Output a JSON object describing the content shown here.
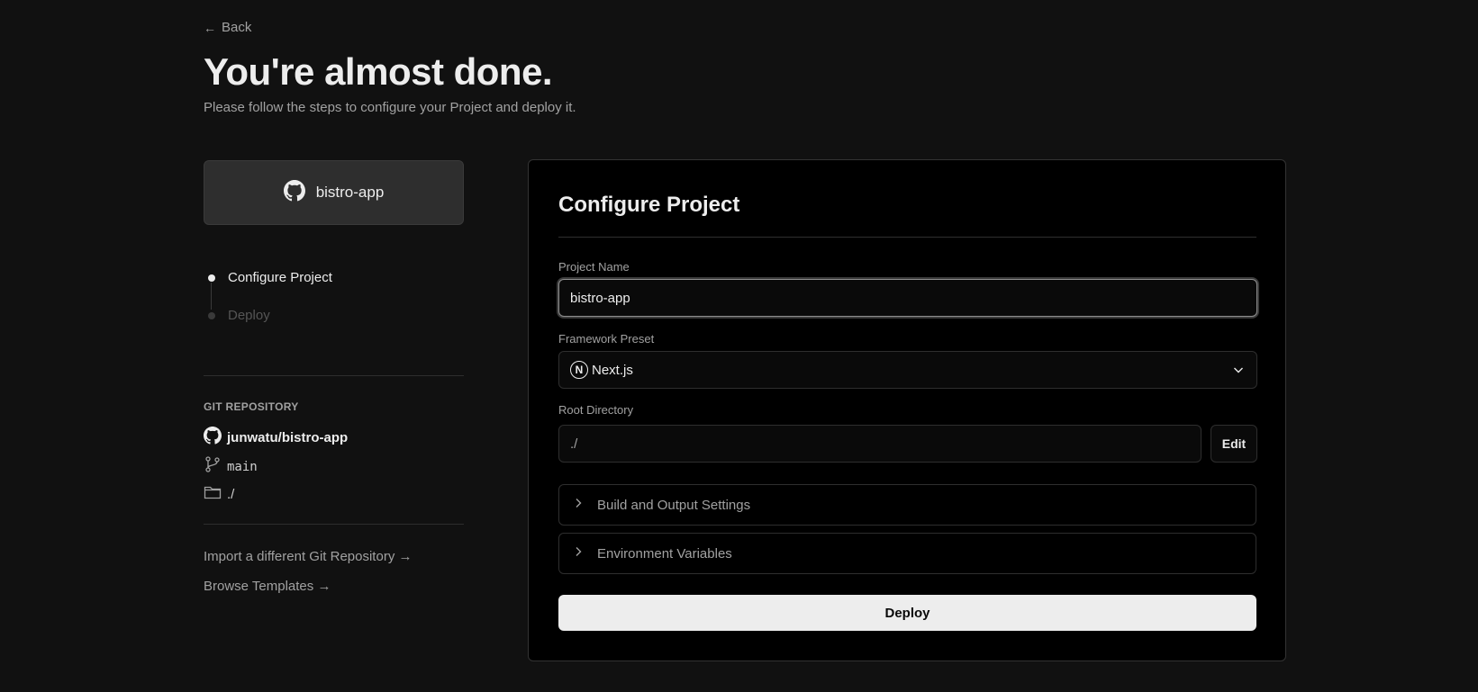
{
  "header": {
    "back_label": "Back",
    "title": "You're almost done.",
    "subtitle": "Please follow the steps to configure your Project and deploy it."
  },
  "repo_card": {
    "icon": "github-icon",
    "name": "bistro-app"
  },
  "steps": [
    {
      "label": "Configure Project",
      "state": "active"
    },
    {
      "label": "Deploy",
      "state": "inactive"
    }
  ],
  "git": {
    "heading": "GIT REPOSITORY",
    "repo": "junwatu/bistro-app",
    "branch": "main",
    "directory": "./"
  },
  "links": {
    "import": "Import a different Git Repository →",
    "templates": "Browse Templates →"
  },
  "panel": {
    "title": "Configure Project",
    "project_name_label": "Project Name",
    "project_name_value": "bistro-app",
    "framework_label": "Framework Preset",
    "framework_value": "Next.js",
    "framework_icon": "nextjs-icon",
    "root_label": "Root Directory",
    "root_value": "./",
    "edit_label": "Edit",
    "accordions": [
      {
        "label": "Build and Output Settings"
      },
      {
        "label": "Environment Variables"
      }
    ],
    "deploy_label": "Deploy"
  },
  "colors": {
    "background": "#111111",
    "panel": "#000000",
    "primary_button": "#ededed",
    "text": "#ededed",
    "muted": "#a1a1a1"
  }
}
